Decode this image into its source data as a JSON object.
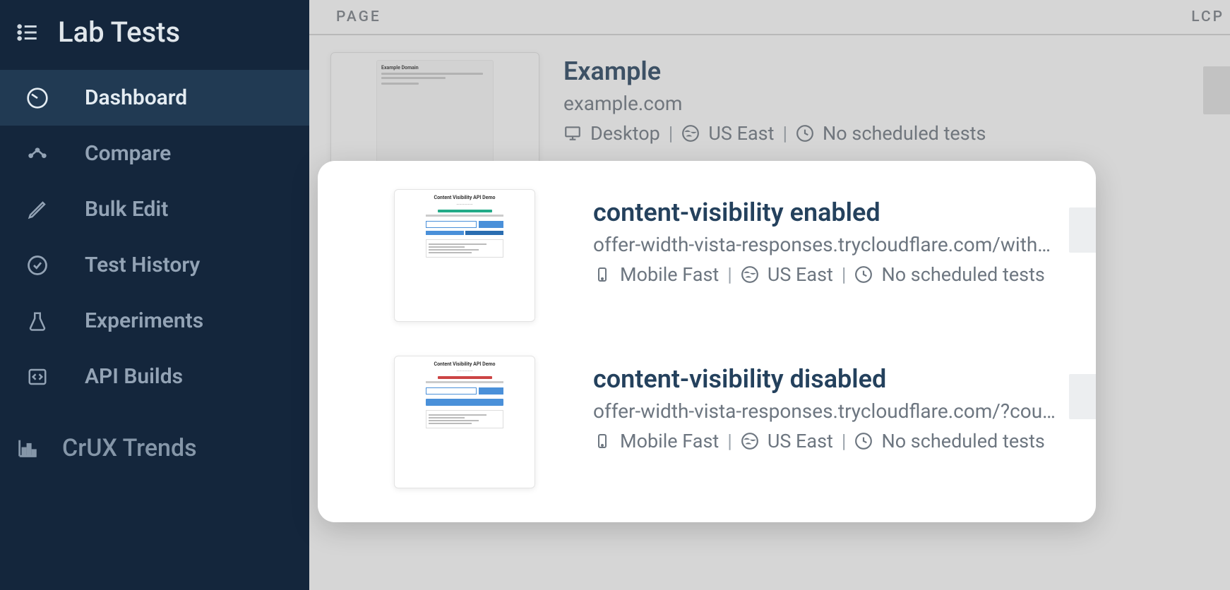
{
  "sidebar": {
    "title": "Lab Tests",
    "items": [
      {
        "label": "Dashboard",
        "icon": "speedometer-icon"
      },
      {
        "label": "Compare",
        "icon": "compare-icon"
      },
      {
        "label": "Bulk Edit",
        "icon": "pencil-icon"
      },
      {
        "label": "Test History",
        "icon": "check-circle-icon"
      },
      {
        "label": "Experiments",
        "icon": "flask-icon"
      },
      {
        "label": "API Builds",
        "icon": "code-box-icon"
      }
    ],
    "secondary": [
      {
        "label": "CrUX Trends",
        "icon": "bar-chart-icon"
      }
    ]
  },
  "columns": {
    "page": "PAGE",
    "lcp": "LCP"
  },
  "rows": [
    {
      "title": "Example",
      "url": "example.com",
      "device": "Desktop",
      "region": "US East",
      "schedule": "No scheduled tests",
      "thumb_title": "Example Domain"
    }
  ],
  "popup_rows": [
    {
      "title": "content-visibility enabled",
      "url": "offer-width-vista-responses.trycloudflare.com/with…",
      "device": "Mobile Fast",
      "region": "US East",
      "schedule": "No scheduled tests",
      "thumb_title": "Content Visibility API Demo"
    },
    {
      "title": "content-visibility disabled",
      "url": "offer-width-vista-responses.trycloudflare.com/?cou…",
      "device": "Mobile Fast",
      "region": "US East",
      "schedule": "No scheduled tests",
      "thumb_title": "Content Visibility API Demo"
    }
  ]
}
